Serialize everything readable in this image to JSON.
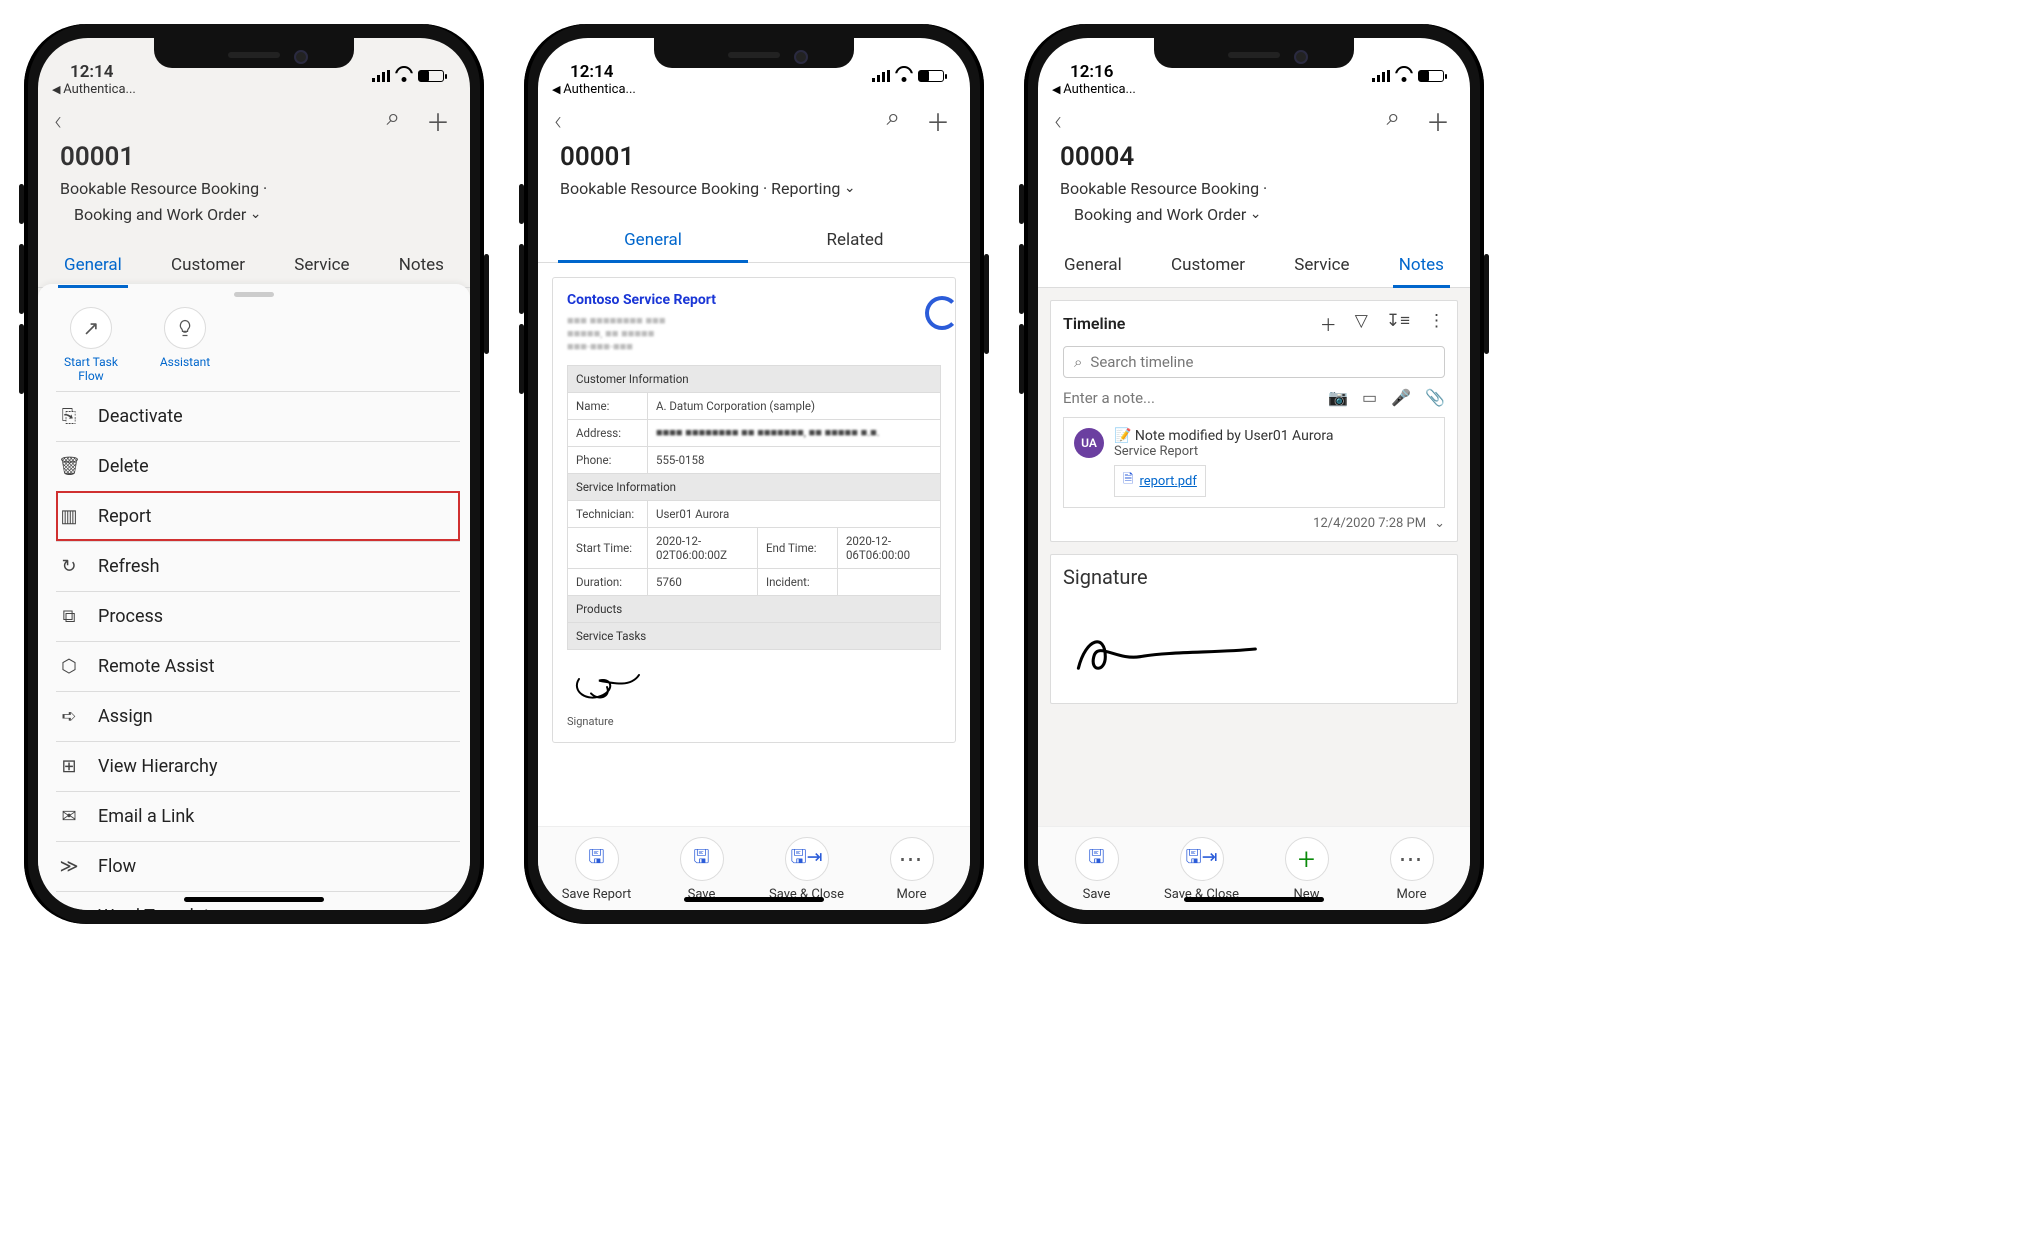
{
  "phone1": {
    "time": "12:14",
    "breadcrumb": "Authentica...",
    "title": "00001",
    "entity": "Bookable Resource Booking",
    "form": "Booking and Work Order",
    "tabs": [
      "General",
      "Customer",
      "Service",
      "Notes"
    ],
    "activeTab": "General",
    "quick": [
      {
        "label": "Start Task Flow",
        "icon": "↗"
      },
      {
        "label": "Assistant",
        "icon": "💡"
      }
    ],
    "menu": [
      {
        "label": "Deactivate",
        "icon": "⎘"
      },
      {
        "label": "Delete",
        "icon": "🗑"
      },
      {
        "label": "Report",
        "icon": "▥",
        "highlight": true
      },
      {
        "label": "Refresh",
        "icon": "↻"
      },
      {
        "label": "Process",
        "icon": "⧉"
      },
      {
        "label": "Remote Assist",
        "icon": "⬡"
      },
      {
        "label": "Assign",
        "icon": "➪"
      },
      {
        "label": "View Hierarchy",
        "icon": "⊞"
      },
      {
        "label": "Email a Link",
        "icon": "✉"
      },
      {
        "label": "Flow",
        "icon": "≫"
      },
      {
        "label": "Word Templates",
        "icon": "W"
      }
    ]
  },
  "phone2": {
    "time": "12:14",
    "breadcrumb": "Authentica...",
    "title": "00001",
    "entity": "Bookable Resource Booking",
    "form": "Reporting",
    "tabs": [
      "General",
      "Related"
    ],
    "activeTab": "General",
    "report": {
      "title": "Contoso Service Report",
      "sections": {
        "customer": {
          "heading": "Customer Information",
          "name": "A. Datum Corporation (sample)",
          "nameLabel": "Name:",
          "addressLabel": "Address:",
          "phoneLabel": "Phone:",
          "phone": "555-0158"
        },
        "service": {
          "heading": "Service Information",
          "technicianLabel": "Technician:",
          "technician": "User01 Aurora",
          "startLabel": "Start Time:",
          "start": "2020-12-02T06:00:00Z",
          "endLabel": "End Time:",
          "end": "2020-12-06T06:00:00",
          "durationLabel": "Duration:",
          "duration": "5760",
          "incidentLabel": "Incident:"
        },
        "products": "Products",
        "tasks": "Service Tasks"
      },
      "signatureLabel": "Signature"
    },
    "bottom": [
      {
        "label": "Save Report",
        "kind": "save"
      },
      {
        "label": "Save",
        "kind": "save"
      },
      {
        "label": "Save & Close",
        "kind": "saveclose"
      },
      {
        "label": "More",
        "kind": "dots"
      }
    ]
  },
  "phone3": {
    "time": "12:16",
    "breadcrumb": "Authentica...",
    "title": "00004",
    "entity": "Bookable Resource Booking",
    "form": "Booking and Work Order",
    "tabs": [
      "General",
      "Customer",
      "Service",
      "Notes"
    ],
    "activeTab": "Notes",
    "timeline": {
      "heading": "Timeline",
      "searchPlaceholder": "Search timeline",
      "enterNote": "Enter a note...",
      "note": {
        "avatar": "UA",
        "title": "Note modified by User01 Aurora",
        "subtitle": "Service Report",
        "attachment": "report.pdf",
        "timestamp": "12/4/2020 7:28 PM"
      }
    },
    "signatureHeading": "Signature",
    "bottom": [
      {
        "label": "Save",
        "kind": "save"
      },
      {
        "label": "Save & Close",
        "kind": "saveclose"
      },
      {
        "label": "New",
        "kind": "new"
      },
      {
        "label": "More",
        "kind": "dots"
      }
    ]
  }
}
